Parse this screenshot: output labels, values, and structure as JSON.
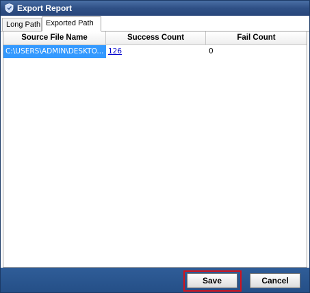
{
  "window": {
    "title": "Export Report"
  },
  "tabs": [
    {
      "label": "Long Path",
      "active": false
    },
    {
      "label": "Exported Path",
      "active": true
    }
  ],
  "grid": {
    "columns": [
      "Source File Name",
      "Success Count",
      "Fail Count"
    ],
    "rows": [
      {
        "source": "C:\\USERS\\ADMIN\\DESKTO...",
        "success": "126",
        "fail": "0",
        "selected": true
      }
    ]
  },
  "buttons": {
    "save": "Save",
    "cancel": "Cancel"
  },
  "colors": {
    "titlebar": "#2f5086",
    "footer": "#254f87",
    "selection": "#3399ff",
    "link": "#0000cc",
    "highlight_box": "#d4121c"
  }
}
